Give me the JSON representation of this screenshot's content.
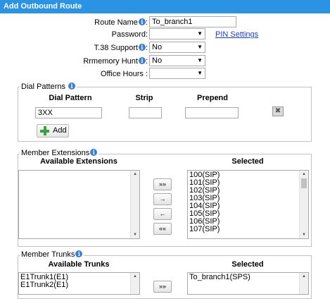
{
  "window": {
    "title": "Add Outbound Route"
  },
  "form": {
    "route_name_label": "Route Name",
    "route_name_value": "To_branch1",
    "password_label": "Password:",
    "password_value": "",
    "pin_settings_link": "PIN Settings",
    "t38_label": "T.38 Support",
    "t38_value": "No",
    "rrmemory_label": "Rrmemory Hunt",
    "rrmemory_value": "No",
    "office_hours_label": "Office Hours :",
    "office_hours_value": ""
  },
  "dial_patterns": {
    "legend": "Dial Patterns",
    "col_pattern": "Dial Pattern",
    "col_strip": "Strip",
    "col_prepend": "Prepend",
    "rows": [
      {
        "pattern": "3XX",
        "strip": "",
        "prepend": ""
      }
    ],
    "add_label": "Add"
  },
  "member_extensions": {
    "legend": "Member Extensions",
    "available_header": "Available Extensions",
    "selected_header": "Selected",
    "available": [],
    "selected": [
      "100(SIP)",
      "101(SIP)",
      "102(SIP)",
      "103(SIP)",
      "104(SIP)",
      "105(SIP)",
      "106(SIP)",
      "107(SIP)"
    ],
    "move_all_right": "»»",
    "move_right": "→",
    "move_left": "←",
    "move_all_left": "««"
  },
  "member_trunks": {
    "legend": "Member Trunks",
    "available_header": "Available Trunks",
    "selected_header": "Selected",
    "available": [
      "E1Trunk1(E1)",
      "E1Trunk2(E1)"
    ],
    "selected": [
      "To_branch1(SPS)"
    ],
    "move_all_right": "»»"
  },
  "colors": {
    "titlebar": "#2b93e3",
    "info_icon": "#3a7fd5",
    "link": "#1a3fcf",
    "add_icon": "#3aa13a"
  }
}
